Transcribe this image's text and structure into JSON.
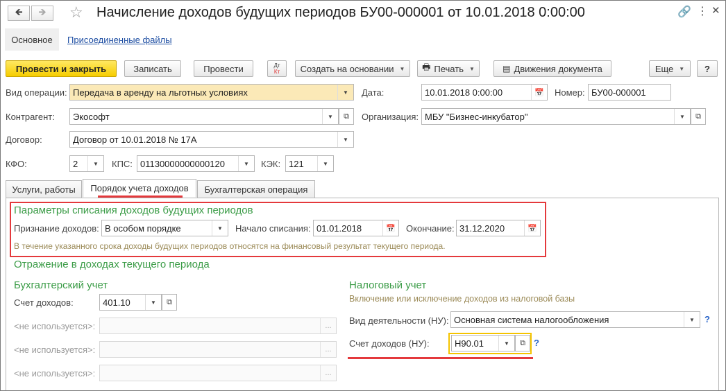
{
  "window": {
    "title": "Начисление доходов будущих периодов БУ00-000001 от 10.01.2018 0:00:00",
    "back_icon": "arrow-left-icon",
    "forward_icon": "arrow-right-icon",
    "favorite_icon": "star-icon",
    "link_icon": "link-icon",
    "menu_icon": "kebab-menu-icon",
    "close_icon": "close-icon"
  },
  "nav": {
    "main_label": "Основное",
    "attached_files_label": "Присоединенные файлы"
  },
  "toolbar": {
    "post_close_label": "Провести и закрыть",
    "save_label": "Записать",
    "post_label": "Провести",
    "dtkt_top": "Дт",
    "dtkt_bottom": "Кт",
    "create_based_label": "Создать на основании",
    "print_label": "Печать",
    "movements_label": "Движения документа",
    "more_label": "Еще",
    "help_label": "?"
  },
  "form": {
    "operation_type_label": "Вид операции:",
    "operation_type_value": "Передача в аренду на льготных условиях",
    "date_label": "Дата:",
    "date_value": "10.01.2018  0:00:00",
    "number_label": "Номер:",
    "number_value": "БУ00-000001",
    "counterparty_label": "Контрагент:",
    "counterparty_value": "Экософт",
    "organization_label": "Организация:",
    "organization_value": "МБУ \"Бизнес-инкубатор\"",
    "contract_label": "Договор:",
    "contract_value": "Договор от 10.01.2018 № 17А",
    "kfo_label": "КФО:",
    "kfo_value": "2",
    "kps_label": "КПС:",
    "kps_value": "01130000000000120",
    "kek_label": "КЭК:",
    "kek_value": "121"
  },
  "tabs": [
    {
      "label": "Услуги, работы",
      "active": false
    },
    {
      "label": "Порядок учета доходов",
      "active": true
    },
    {
      "label": "Бухгалтерская операция",
      "active": false
    }
  ],
  "params": {
    "heading": "Параметры списания доходов будущих периодов",
    "recognition_label": "Признание доходов:",
    "recognition_value": "В особом порядке",
    "start_label": "Начало списания:",
    "start_value": "01.01.2018",
    "end_label": "Окончание:",
    "end_value": "31.12.2020",
    "note": "В течение указанного срока доходы будущих периодов относятся на финансовый результат текущего периода."
  },
  "reflection": {
    "heading": "Отражение в доходах текущего периода"
  },
  "accounting": {
    "heading": "Бухгалтерский учет",
    "income_account_label": "Счет доходов:",
    "income_account_value": "401.10",
    "unused_1": "<не используется>:",
    "unused_2": "<не используется>:",
    "unused_3": "<не используется>:",
    "ellipsis": "..."
  },
  "tax": {
    "heading": "Налоговый учет",
    "subheading": "Включение или исключение доходов из налоговой базы",
    "activity_label": "Вид деятельности (НУ):",
    "activity_value": "Основная система налогообложения",
    "income_account_label": "Счет доходов (НУ):",
    "income_account_value": "Н90.01",
    "help_1": "?",
    "help_2": "?"
  },
  "colors": {
    "highlight_red": "#e4393c",
    "green_heading": "#3b9c47",
    "yellow_focus": "#f5c400",
    "primary_button": "#f6cd00"
  }
}
